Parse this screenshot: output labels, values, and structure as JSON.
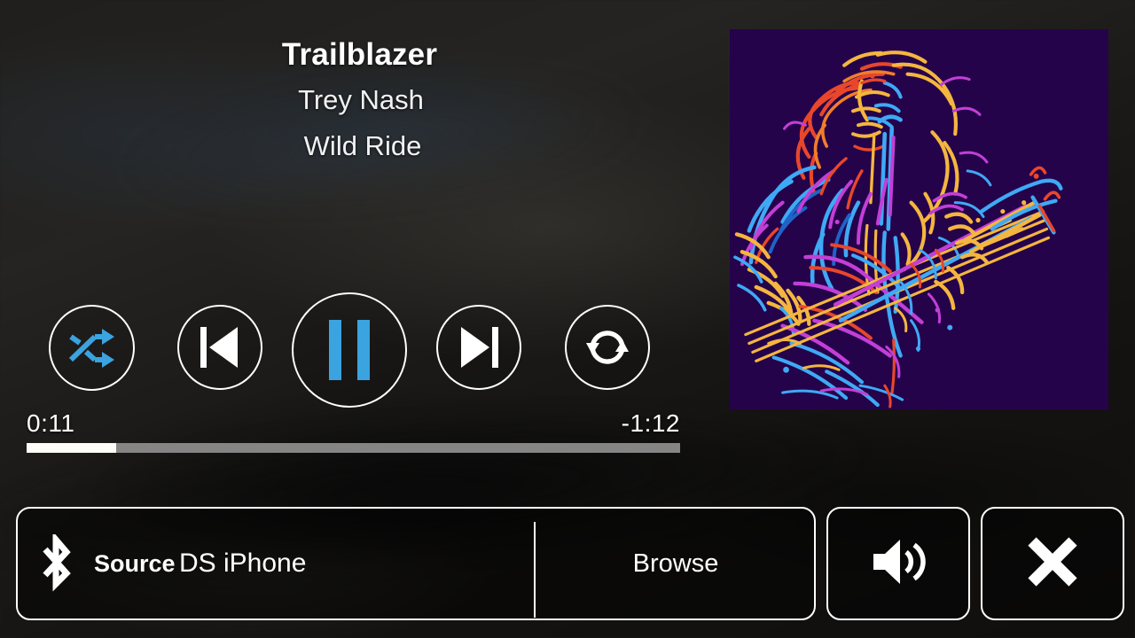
{
  "now_playing": {
    "title": "Trailblazer",
    "artist": "Trey Nash",
    "album": "Wild Ride"
  },
  "album_art": {
    "icon": "album-art-guitarist-neon",
    "background_color": "#25034b",
    "palette": [
      "#f4b63f",
      "#3fa9f5",
      "#e8472c",
      "#c23fd6",
      "#1f63c8",
      "#f07e2a"
    ]
  },
  "transport": {
    "shuffle": {
      "icon": "shuffle-icon",
      "label": "Shuffle",
      "active": true,
      "color": "#3ba3e0"
    },
    "previous": {
      "icon": "previous-track-icon",
      "label": "Previous",
      "color": "#ffffff"
    },
    "play_pause": {
      "icon": "pause-icon",
      "label": "Pause",
      "state": "playing",
      "color": "#3ba3e0"
    },
    "next": {
      "icon": "next-track-icon",
      "label": "Next",
      "color": "#ffffff"
    },
    "repeat": {
      "icon": "repeat-icon",
      "label": "Repeat",
      "active": false,
      "color": "#ffffff"
    }
  },
  "progress": {
    "elapsed": "0:11",
    "remaining": "-1:12",
    "percent": 13.7,
    "fill_color": "#fdfdf7",
    "track_color": "#858585"
  },
  "bottom_bar": {
    "source": {
      "icon": "bluetooth-icon",
      "label": "Source",
      "value": "DS iPhone"
    },
    "browse": {
      "label": "Browse"
    },
    "volume": {
      "icon": "volume-icon",
      "label": "Volume"
    },
    "close": {
      "icon": "close-icon",
      "label": "Close"
    }
  }
}
